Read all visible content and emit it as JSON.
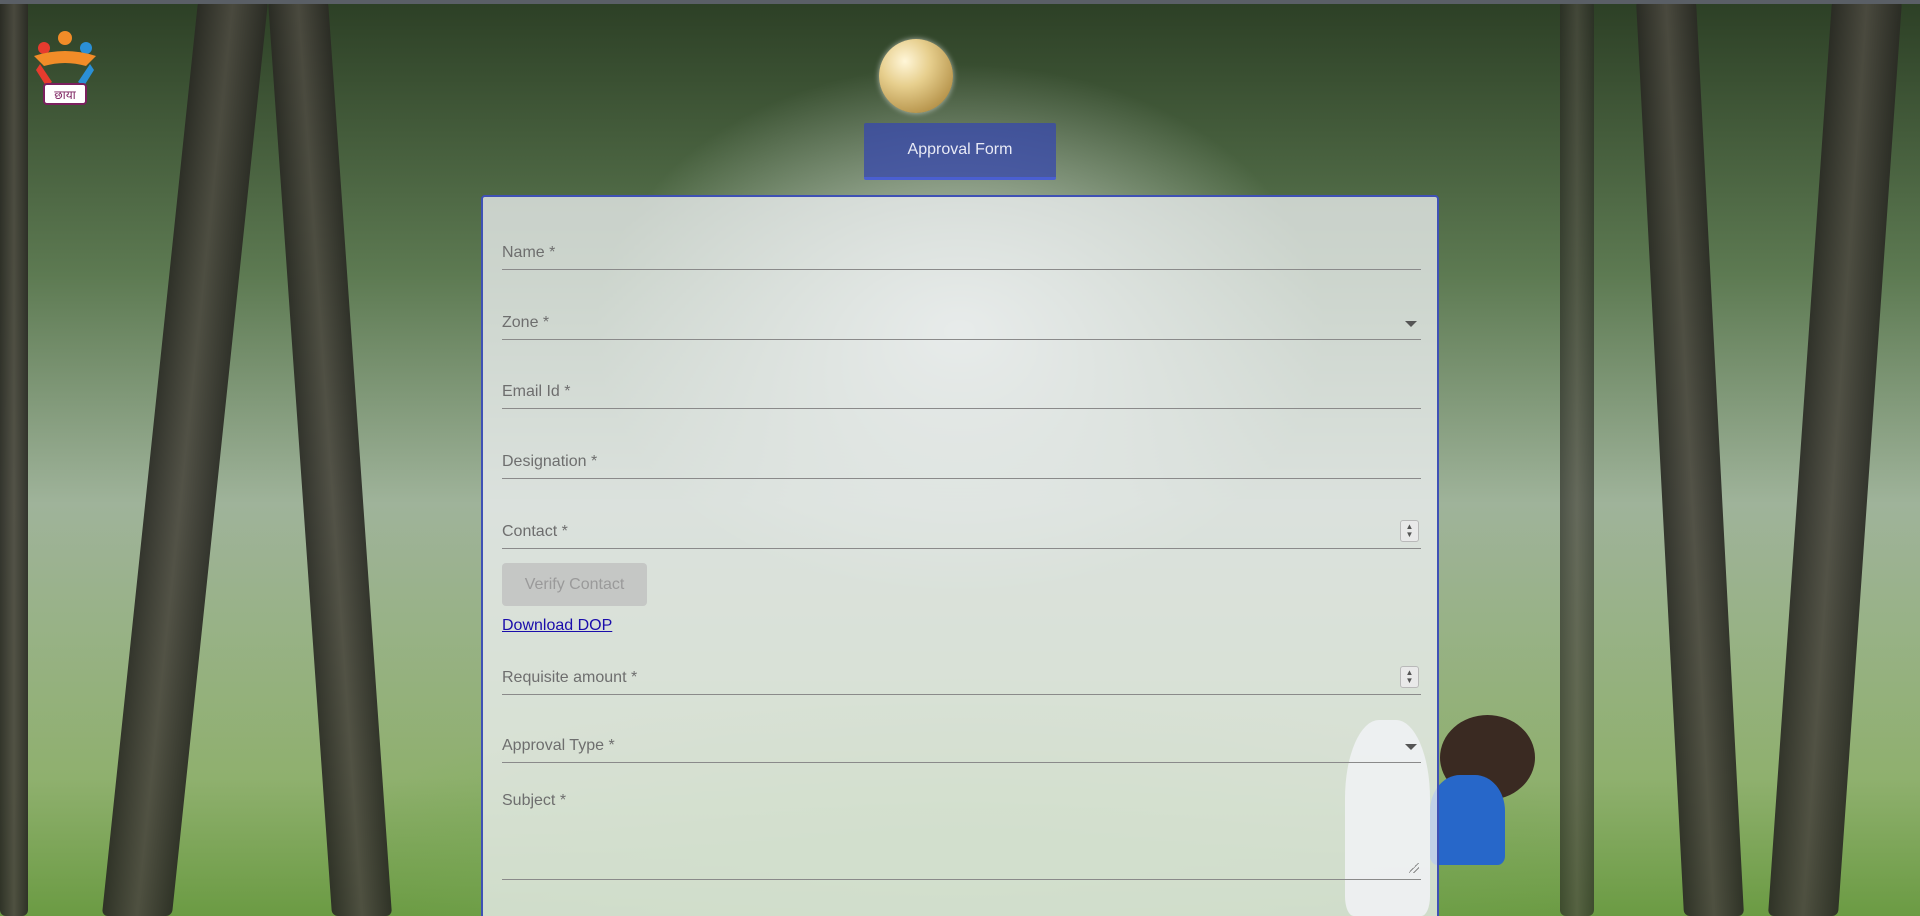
{
  "app": {
    "logo_name": "chhaya-logo",
    "header_button": "Approval Form"
  },
  "form": {
    "name_label": "Name *",
    "zone_label": "Zone *",
    "email_label": "Email Id *",
    "designation_label": "Designation *",
    "contact_label": "Contact *",
    "verify_button": "Verify Contact",
    "download_link": "Download DOP",
    "amount_label": "Requisite amount *",
    "approval_type_label": "Approval Type *",
    "subject_label": "Subject *"
  },
  "colors": {
    "accent": "#3f51b5",
    "link": "#1a0dab"
  }
}
